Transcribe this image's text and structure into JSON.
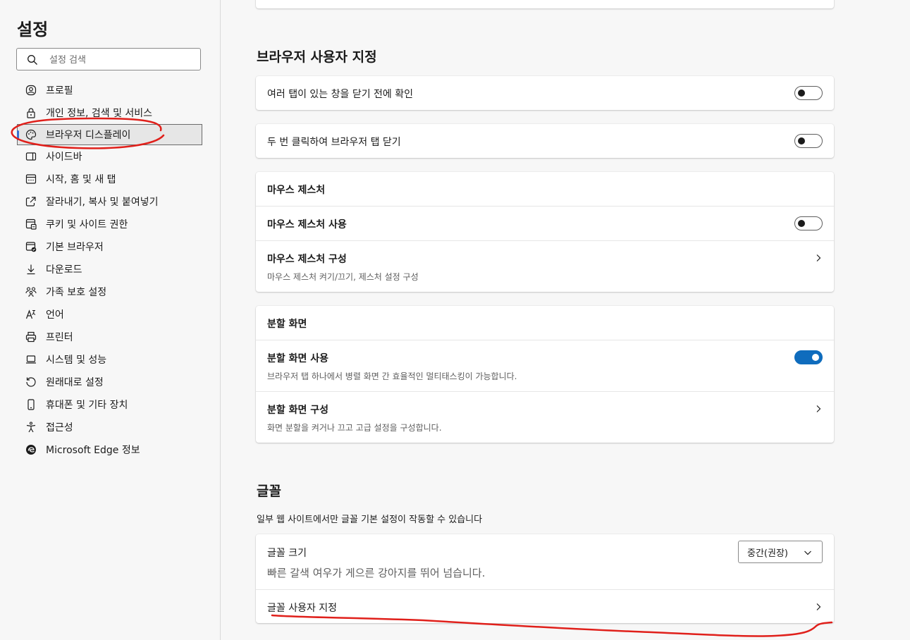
{
  "sidebar": {
    "title": "설정",
    "search_placeholder": "설정 검색",
    "items": [
      {
        "label": "프로필",
        "icon": "profile-icon"
      },
      {
        "label": "개인 정보, 검색 및 서비스",
        "icon": "lock-icon"
      },
      {
        "label": "브라우저 디스플레이",
        "icon": "palette-icon",
        "selected": true
      },
      {
        "label": "사이드바",
        "icon": "sidebar-icon"
      },
      {
        "label": "시작, 홈 및 새 탭",
        "icon": "home-tab-icon"
      },
      {
        "label": "잘라내기, 복사 및 붙여넣기",
        "icon": "share-icon"
      },
      {
        "label": "쿠키 및 사이트 권한",
        "icon": "cookie-icon"
      },
      {
        "label": "기본 브라우저",
        "icon": "default-browser-icon"
      },
      {
        "label": "다운로드",
        "icon": "download-icon"
      },
      {
        "label": "가족 보호 설정",
        "icon": "family-icon"
      },
      {
        "label": "언어",
        "icon": "language-icon"
      },
      {
        "label": "프린터",
        "icon": "printer-icon"
      },
      {
        "label": "시스템 및 성능",
        "icon": "laptop-icon"
      },
      {
        "label": "원래대로 설정",
        "icon": "reset-icon"
      },
      {
        "label": "휴대폰 및 기타 장치",
        "icon": "phone-icon"
      },
      {
        "label": "접근성",
        "icon": "accessibility-icon"
      },
      {
        "label": "Microsoft Edge 정보",
        "icon": "edge-logo-icon"
      }
    ]
  },
  "main": {
    "browser_customization": {
      "title": "브라우저 사용자 지정",
      "confirm_close_tabs": {
        "label": "여러 탭이 있는 창을 닫기 전에 확인",
        "enabled": false
      },
      "double_click_close": {
        "label": "두 번 클릭하여 브라우저 탭 닫기",
        "enabled": false
      },
      "mouse_gesture": {
        "header": "마우스 제스처",
        "use": {
          "label": "마우스 제스처 사용",
          "enabled": false
        },
        "configure": {
          "label": "마우스 제스처 구성",
          "description": "마우스 제스처 켜기/끄기, 제스처 설정 구성"
        }
      },
      "split_screen": {
        "header": "분할 화면",
        "use": {
          "label": "분할 화면 사용",
          "description": "브라우저 탭 하나에서 병렬 화면 간 효율적인 멀티태스킹이 가능합니다.",
          "enabled": true
        },
        "configure": {
          "label": "분할 화면 구성",
          "description": "화면 분할을 켜거나 끄고 고급 설정을 구성합니다."
        }
      }
    },
    "fonts": {
      "title": "글꼴",
      "note": "일부 웹 사이트에서만 글꼴 기본 설정이 작동할 수 있습니다",
      "font_size": {
        "label": "글꼴 크기",
        "preview": "빠른 갈색 여우가 게으른 강아지를 뛰어 넘습니다.",
        "selected": "중간(권장)"
      },
      "customize": {
        "label": "글꼴 사용자 지정"
      }
    }
  },
  "colors": {
    "accent": "#0f6cbd",
    "annotation": "#e0201b"
  }
}
